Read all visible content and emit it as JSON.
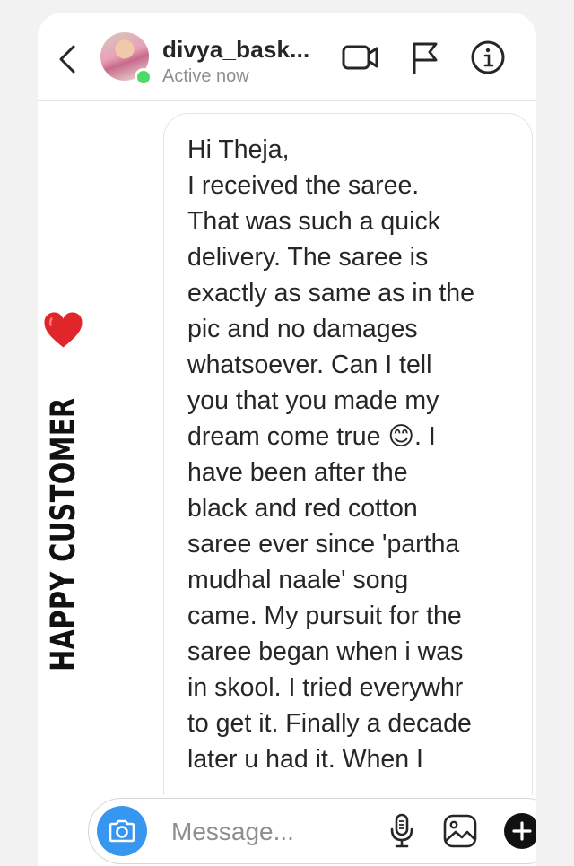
{
  "header": {
    "username": "divya_bask...",
    "status": "Active now",
    "back_icon": "chevron-left-icon",
    "video_icon": "video-camera-icon",
    "flag_icon": "flag-icon",
    "info_icon": "info-icon"
  },
  "side_label": {
    "text": "HAPPY CUSTOMER",
    "icon": "heart-icon",
    "icon_color": "#e0252b"
  },
  "message": {
    "lines": [
      "Hi Theja,",
      "I received the saree.",
      "That was such a quick",
      "delivery. The saree is",
      "exactly as same as in the",
      "pic and no damages",
      "whatsoever. Can I tell",
      "you that you made my",
      "dream come true 😊. I",
      "have been after the",
      "black and red cotton",
      "saree ever since 'partha",
      "mudhal naale' song",
      "came. My pursuit for the",
      "saree began when i was",
      "in skool. I tried everywhr",
      "to get it. Finally a decade",
      "later u had it. When I"
    ]
  },
  "composer": {
    "placeholder": "Message...",
    "camera_icon": "camera-icon",
    "mic_icon": "microphone-icon",
    "gallery_icon": "image-gallery-icon",
    "plus_icon": "plus-circle-icon",
    "accent": "#3797f0"
  }
}
